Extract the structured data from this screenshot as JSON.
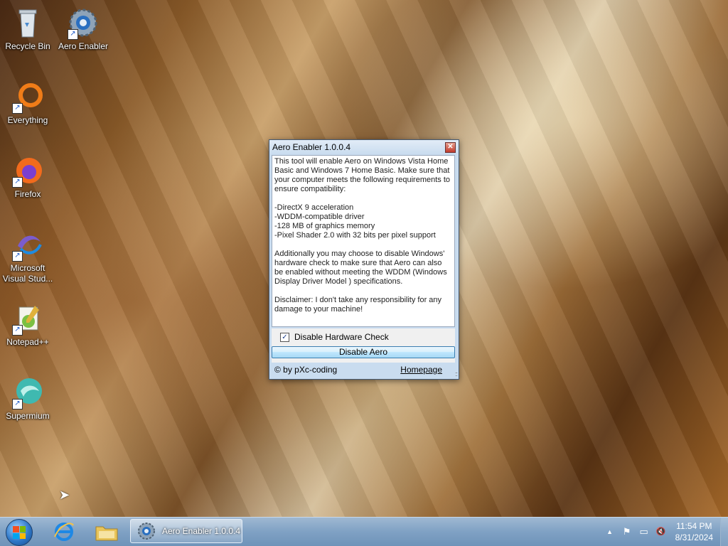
{
  "desktop": {
    "icons": [
      {
        "label": "Recycle Bin"
      },
      {
        "label": "Aero Enabler"
      },
      {
        "label": "Everything"
      },
      {
        "label": "Firefox"
      },
      {
        "label": "Microsoft Visual Stud..."
      },
      {
        "label": "Notepad++"
      },
      {
        "label": "Supermium"
      }
    ]
  },
  "window": {
    "title": "Aero Enabler 1.0.0.4",
    "close_glyph": "✕",
    "description": {
      "intro": "This tool will enable Aero on Windows Vista Home Basic and Windows 7 Home Basic. Make sure that your computer meets the following requirements to ensure compatibility:",
      "requirements": [
        "-DirectX 9 acceleration",
        "-WDDM-compatible driver",
        "-128 MB of graphics memory",
        "-Pixel Shader 2.0 with 32 bits per pixel support"
      ],
      "additional": "Additionally you may choose to disable Windows' hardware check to make sure that Aero can also be enabled without meeting the WDDM (Windows Display Driver Model ) specifications.",
      "disclaimer": "Disclaimer: I don't take any responsibility for any damage to your machine!"
    },
    "checkbox": {
      "label": "Disable Hardware Check",
      "checked": true,
      "glyph": "✓"
    },
    "primary_button": "Disable Aero",
    "footer": {
      "copyright": "© by pXc-coding",
      "link": "Homepage",
      "grip": "::"
    }
  },
  "taskbar": {
    "active_task": "Aero Enabler 1.0.0.4",
    "tray": {
      "chevron": "▲",
      "flag_icon": "⚑",
      "monitor_icon": "▭",
      "volume_icon": "🔇"
    },
    "clock": {
      "time": "11:54 PM",
      "date": "8/31/2024"
    }
  },
  "colors": {
    "accent": "#3c7fb1",
    "taskbar": "#7fa1c4",
    "window_frame": "#c9dcef"
  }
}
